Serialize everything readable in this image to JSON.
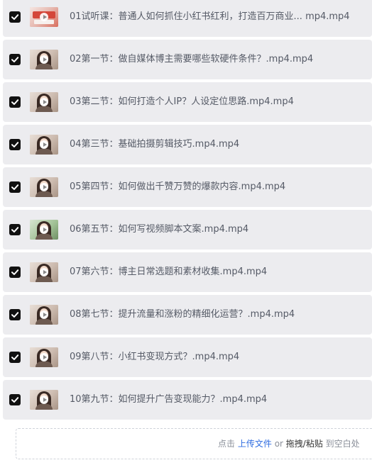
{
  "files": [
    {
      "name": "01试听课：普通人如何抓住小红书红利，打造百万商业... mp4.mp4",
      "checked": true,
      "thumb": "red"
    },
    {
      "name": "02第一节：做自媒体博主需要哪些软硬件条件？.mp4.mp4",
      "checked": true,
      "thumb": "portrait"
    },
    {
      "name": "03第二节：如何打造个人IP？人设定位思路.mp4.mp4",
      "checked": true,
      "thumb": "portrait"
    },
    {
      "name": "04第三节：基础拍摄剪辑技巧.mp4.mp4",
      "checked": true,
      "thumb": "portrait"
    },
    {
      "name": "05第四节：如何做出千赞万赞的爆款内容.mp4.mp4",
      "checked": true,
      "thumb": "portrait"
    },
    {
      "name": "06第五节：如何写视频脚本文案.mp4.mp4",
      "checked": true,
      "thumb": "green"
    },
    {
      "name": "07第六节：博主日常选题和素材收集.mp4.mp4",
      "checked": true,
      "thumb": "portrait"
    },
    {
      "name": "08第七节：提升流量和涨粉的精细化运营？.mp4.mp4",
      "checked": true,
      "thumb": "portrait"
    },
    {
      "name": "09第八节：小红书变现方式？.mp4.mp4",
      "checked": true,
      "thumb": "portrait"
    },
    {
      "name": "10第九节：如何提升广告变现能力？.mp4.mp4",
      "checked": true,
      "thumb": "portrait"
    }
  ],
  "upload": {
    "prefix": "点击",
    "link": "上传文件",
    "or": "or",
    "strong": "拖拽/粘贴",
    "suffix": "到空白处"
  },
  "colors": {
    "row_bg": "#ececef",
    "checkbox": "#111111",
    "link": "#2f6de1",
    "text": "#555a66"
  },
  "icons": {
    "checkbox": "checkmark-icon",
    "play": "play-icon"
  }
}
